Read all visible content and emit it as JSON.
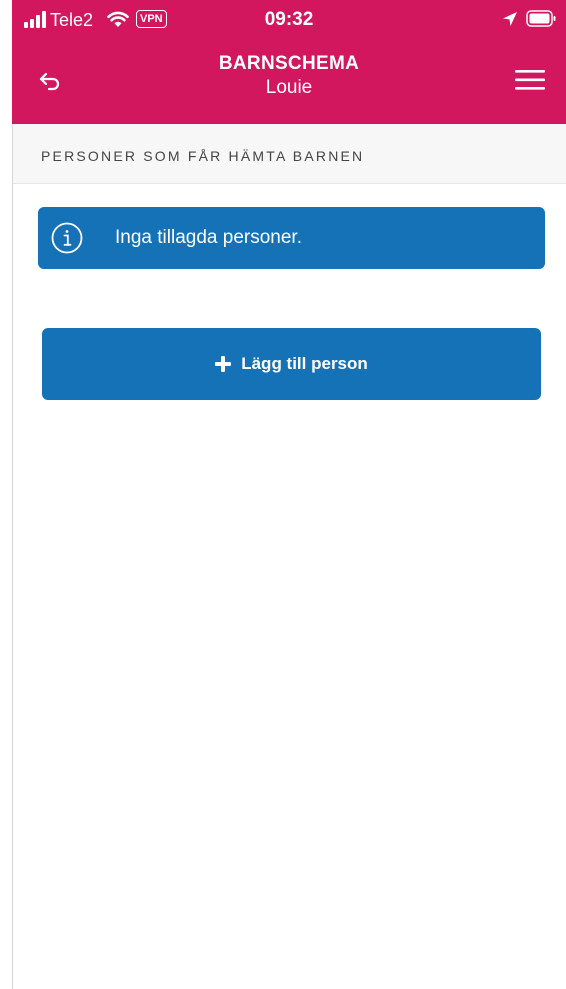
{
  "status_bar": {
    "carrier": "Tele2",
    "vpn": "VPN",
    "time": "09:32",
    "signal_icon": "signal-bars",
    "wifi_icon": "wifi",
    "location_icon": "location-arrow",
    "battery_icon": "battery"
  },
  "nav": {
    "title": "BARNSCHEMA",
    "subtitle": "Louie",
    "back_icon": "back-arrow",
    "menu_icon": "hamburger-menu"
  },
  "section": {
    "title": "PERSONER SOM FÅR HÄMTA BARNEN"
  },
  "info_message": {
    "icon": "info",
    "text": "Inga tillagda personer."
  },
  "add_button": {
    "icon": "plus",
    "label": "Lägg till person"
  },
  "colors": {
    "header_bg": "#d3175f",
    "primary_blue": "#1572b6",
    "section_bg": "#f7f7f7",
    "text_dark": "#444444"
  }
}
